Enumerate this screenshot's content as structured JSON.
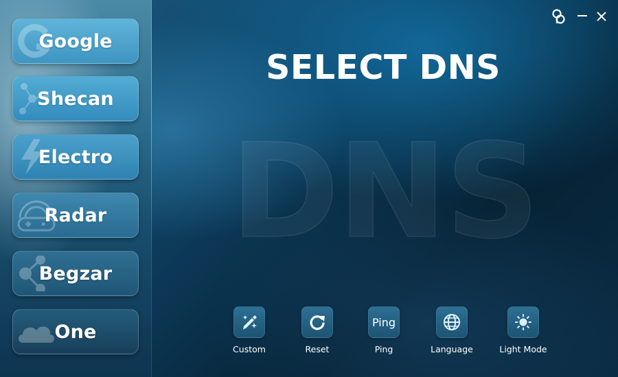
{
  "window": {
    "title": "SELECT DNS",
    "watermark": "DNS",
    "controls": [
      "logo-icon",
      "minimize-icon",
      "close-icon"
    ]
  },
  "sidebar": {
    "items": [
      {
        "label": "Google",
        "icon": "google-icon"
      },
      {
        "label": "Shecan",
        "icon": "network-nodes-icon"
      },
      {
        "label": "Electro",
        "icon": "lightning-icon"
      },
      {
        "label": "Radar",
        "icon": "gamepad-radar-icon"
      },
      {
        "label": "Begzar",
        "icon": "share-nodes-icon"
      },
      {
        "label": "One",
        "icon": "cloud-icon"
      }
    ]
  },
  "toolbar": {
    "custom_label": "Custom",
    "reset_label": "Reset",
    "ping_label": "Ping",
    "ping_icon_text": "Ping",
    "language_label": "Language",
    "light_mode_label": "Light Mode"
  },
  "colors": {
    "accent": "#4aa6d0",
    "background_dark": "#062234",
    "text": "#ffffff"
  }
}
